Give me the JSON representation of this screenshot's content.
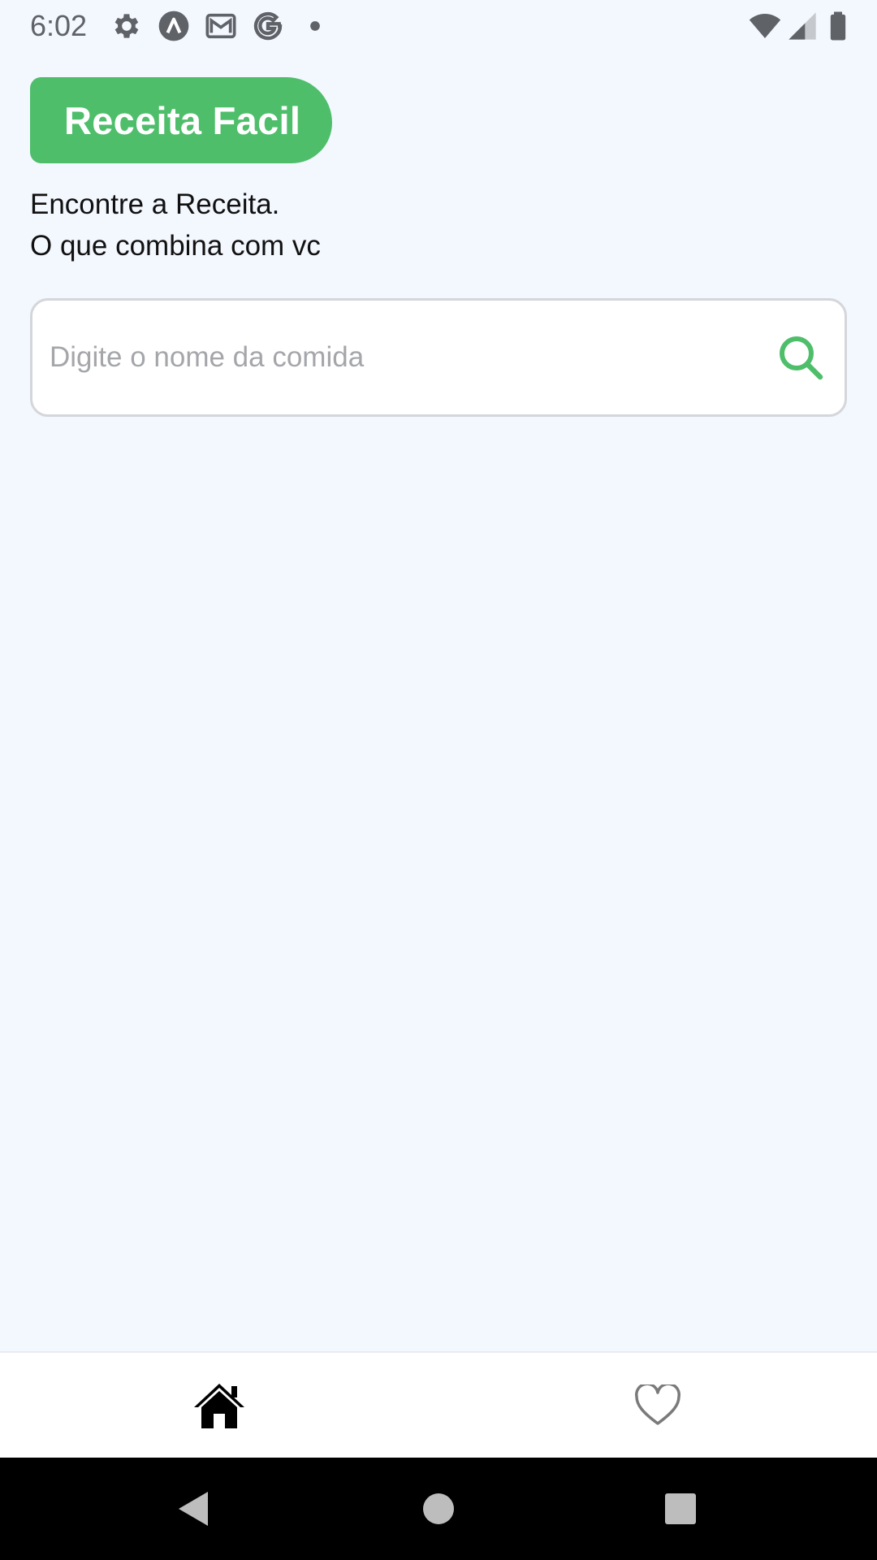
{
  "status_bar": {
    "time": "6:02",
    "left_icons": [
      "gear-icon",
      "app-a-icon",
      "gmail-icon",
      "google-icon",
      "dot-icon"
    ],
    "right_icons": [
      "wifi-icon",
      "signal-icon",
      "battery-icon"
    ]
  },
  "header": {
    "app_title": "Receita Facil",
    "subtitle_line1": "Encontre a Receita.",
    "subtitle_line2": "O que combina com vc"
  },
  "search": {
    "placeholder": "Digite o nome da comida",
    "value": "",
    "icon": "search-icon"
  },
  "tab_bar": {
    "tabs": [
      {
        "id": "home",
        "icon": "home-icon",
        "active": true
      },
      {
        "id": "favorites",
        "icon": "heart-icon",
        "active": false
      }
    ]
  },
  "nav_bar": {
    "buttons": [
      "back-icon",
      "home-circle-icon",
      "recents-icon"
    ]
  },
  "colors": {
    "background": "#f3f7fe",
    "brand_green": "#4fbe6b",
    "text": "#111111",
    "placeholder": "#a4a6aa",
    "status_icons": "#5f6368"
  }
}
